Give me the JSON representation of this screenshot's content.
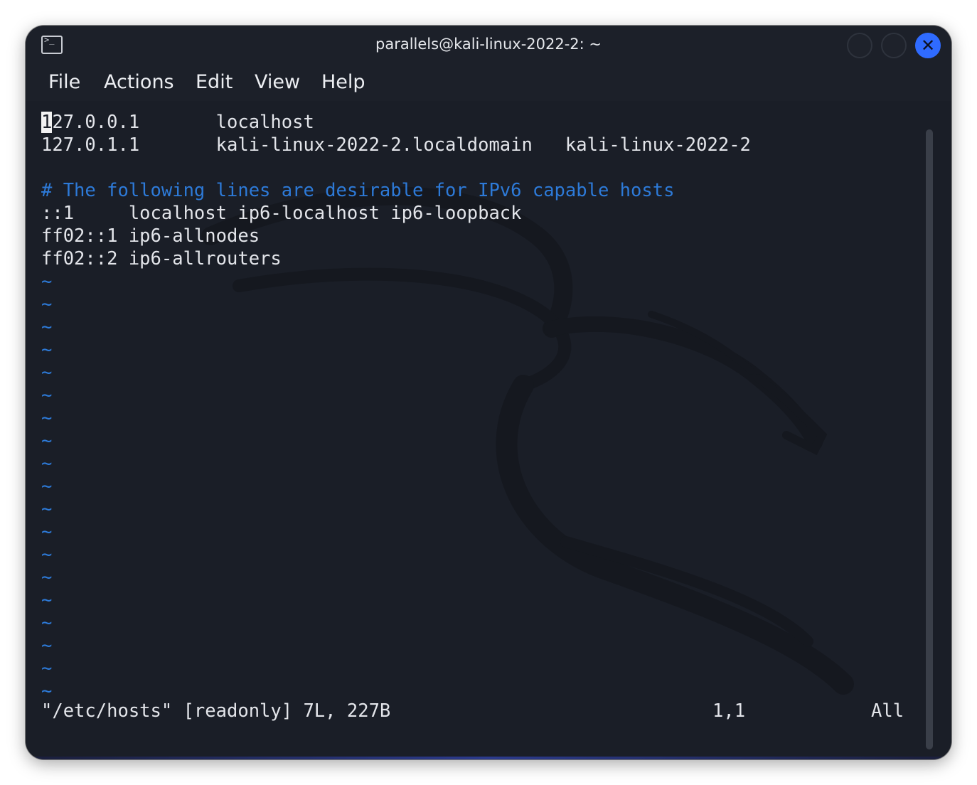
{
  "window": {
    "title": "parallels@kali-linux-2022-2: ~",
    "icon": "terminal-icon",
    "close_glyph": "✕",
    "accent_color": "#2f6bff"
  },
  "menu": {
    "items": [
      {
        "label": "File"
      },
      {
        "label": "Actions"
      },
      {
        "label": "Edit"
      },
      {
        "label": "View"
      },
      {
        "label": "Help"
      }
    ]
  },
  "editor": {
    "cursor_char": "1",
    "line1_rest": "27.0.0.1       localhost",
    "line2": "127.0.1.1       kali-linux-2022-2.localdomain   kali-linux-2022-2",
    "line3": "",
    "line4": "# The following lines are desirable for IPv6 capable hosts",
    "line5": "::1     localhost ip6-localhost ip6-loopback",
    "line6": "ff02::1 ip6-allnodes",
    "line7": "ff02::2 ip6-allrouters",
    "tilde": "~",
    "comment_color": "#2d7ad8"
  },
  "status": {
    "file_info": "\"/etc/hosts\" [readonly] 7L, 227B",
    "position": "1,1",
    "scroll": "All"
  }
}
